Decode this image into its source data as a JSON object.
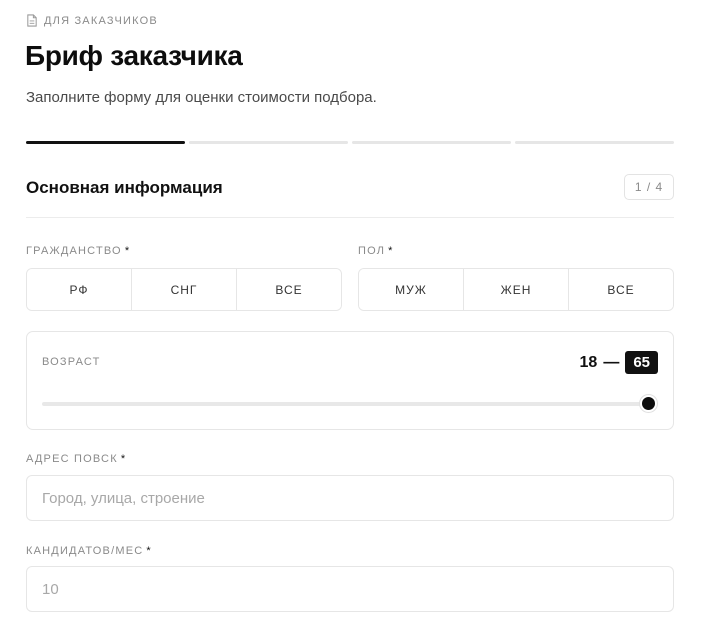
{
  "header": {
    "eyebrow": "ДЛЯ ЗАКАЗЧИКОВ",
    "title": "Бриф заказчика",
    "subtitle": "Заполните форму для оценки стоимости подбора."
  },
  "progress": {
    "current_step": 1,
    "total_steps": 4
  },
  "section": {
    "title": "Основная информация",
    "step_badge": "1 / 4"
  },
  "citizenship": {
    "label": "ГРАЖДАНСТВО",
    "required_mark": "*",
    "options": [
      "РФ",
      "СНГ",
      "ВСЕ"
    ]
  },
  "gender": {
    "label": "ПОЛ",
    "required_mark": "*",
    "options": [
      "МУЖ",
      "ЖЕН",
      "ВСЕ"
    ]
  },
  "age": {
    "label": "ВОЗРАСТ",
    "min": "18",
    "separator": "—",
    "max": "65"
  },
  "address": {
    "label": "АДРЕС ПОВСК",
    "required_mark": "*",
    "value": "",
    "placeholder": "Город, улица, строение"
  },
  "candidates": {
    "label": "КАНДИДАТОВ/МЕС",
    "required_mark": "*",
    "value": "",
    "placeholder": "10"
  },
  "colors": {
    "accent": "#111111",
    "border": "#e6e6e6",
    "muted": "#8a8a8a"
  }
}
